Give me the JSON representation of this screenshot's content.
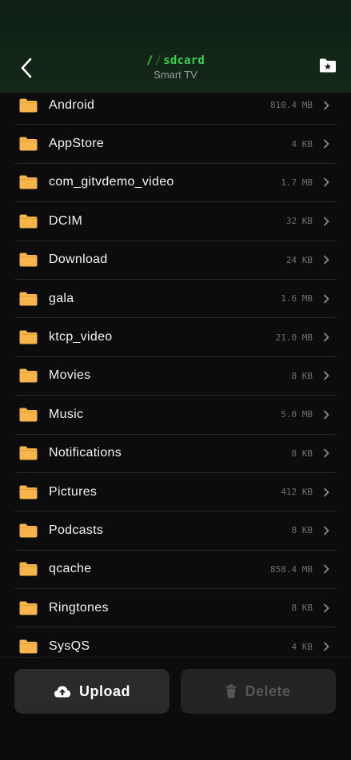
{
  "header": {
    "path_root": "/",
    "path_sep": "/",
    "path_current": "sdcard",
    "device_name": "Smart TV"
  },
  "colors": {
    "accent": "#3dd24f",
    "folder": "#f7b54a",
    "background": "#0c0c0c"
  },
  "files": [
    {
      "name": "Android",
      "size": "810.4 MB"
    },
    {
      "name": "AppStore",
      "size": "4 KB"
    },
    {
      "name": "com_gitvdemo_video",
      "size": "1.7 MB"
    },
    {
      "name": "DCIM",
      "size": "32 KB"
    },
    {
      "name": "Download",
      "size": "24 KB"
    },
    {
      "name": "gala",
      "size": "1.6 MB"
    },
    {
      "name": "ktcp_video",
      "size": "21.0 MB"
    },
    {
      "name": "Movies",
      "size": "8 KB"
    },
    {
      "name": "Music",
      "size": "5.0 MB"
    },
    {
      "name": "Notifications",
      "size": "8 KB"
    },
    {
      "name": "Pictures",
      "size": "412 KB"
    },
    {
      "name": "Podcasts",
      "size": "8 KB"
    },
    {
      "name": "qcache",
      "size": "858.4 MB"
    },
    {
      "name": "Ringtones",
      "size": "8 KB"
    },
    {
      "name": "SysQS",
      "size": "4 KB"
    }
  ],
  "footer": {
    "upload_label": "Upload",
    "delete_label": "Delete"
  }
}
